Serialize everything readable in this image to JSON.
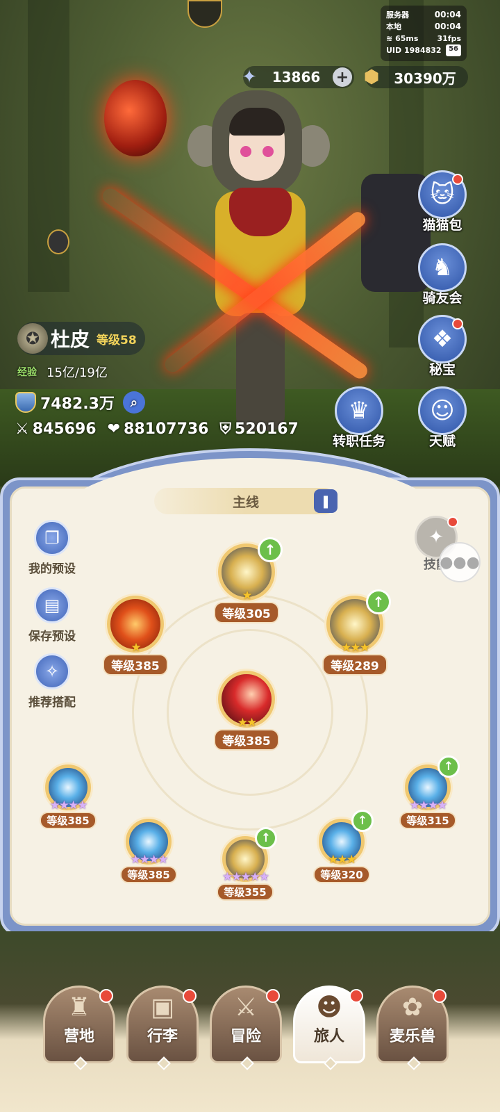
{
  "status": {
    "server_label": "服务器",
    "server_time": "00:04",
    "local_label": "本地",
    "local_time": "00:04",
    "ping": "65ms",
    "fps": "31fps",
    "uid": "UID 1984832",
    "battery": "56"
  },
  "currency": {
    "stars": "13866",
    "plus": "+",
    "coins": "30390万"
  },
  "side_menu": [
    {
      "label": "猫猫包",
      "icon": "cat-bag-icon",
      "dot": true
    },
    {
      "label": "骑友会",
      "icon": "horse-icon",
      "dot": false
    },
    {
      "label": "秘宝",
      "icon": "treasure-icon",
      "dot": true
    },
    {
      "label": "天赋",
      "icon": "talent-icon",
      "dot": false
    },
    {
      "label": "转职任务",
      "icon": "crown-icon",
      "dot": false
    }
  ],
  "player": {
    "name": "杜皮",
    "level": "等级58",
    "exp_tag": "经验",
    "exp": "15亿/19亿",
    "power": "7482.3万",
    "attack": "845696",
    "hp": "88107736",
    "defense": "520167"
  },
  "panel": {
    "tab": "主线",
    "tools": [
      "我的预设",
      "保存预设",
      "推荐搭配"
    ],
    "skill_btn": "技能"
  },
  "skills": [
    {
      "level": "等级305",
      "stars": "★",
      "star_color": "gold",
      "up": true
    },
    {
      "level": "等级385",
      "stars": "★",
      "star_color": "gold",
      "up": false
    },
    {
      "level": "等级289",
      "stars": "★★★",
      "star_color": "gold",
      "up": true
    },
    {
      "level": "等级385",
      "stars": "★★",
      "star_color": "gold",
      "up": false
    },
    {
      "level": "等级385",
      "stars": "★★★★",
      "star_color": "purple",
      "up": false
    },
    {
      "level": "等级315",
      "stars": "★★★★",
      "star_color": "purple",
      "up": true
    },
    {
      "level": "等级385",
      "stars": "★★★★",
      "star_color": "purple",
      "up": false
    },
    {
      "level": "等级355",
      "stars": "★★★★★",
      "star_color": "purple",
      "up": true
    },
    {
      "level": "等级320",
      "stars": "★★★",
      "star_color": "gold",
      "up": true
    }
  ],
  "nav": [
    {
      "label": "营地",
      "icon": "castle-icon"
    },
    {
      "label": "行李",
      "icon": "chest-icon"
    },
    {
      "label": "冒险",
      "icon": "swords-icon"
    },
    {
      "label": "旅人",
      "icon": "traveler-icon"
    },
    {
      "label": "麦乐兽",
      "icon": "fox-icon"
    }
  ],
  "colors": {
    "accent_blue": "#7c94c8",
    "level_badge": "#a65a2a",
    "alert_red": "#e84a3a",
    "upgrade_green": "#6cbf4a"
  }
}
